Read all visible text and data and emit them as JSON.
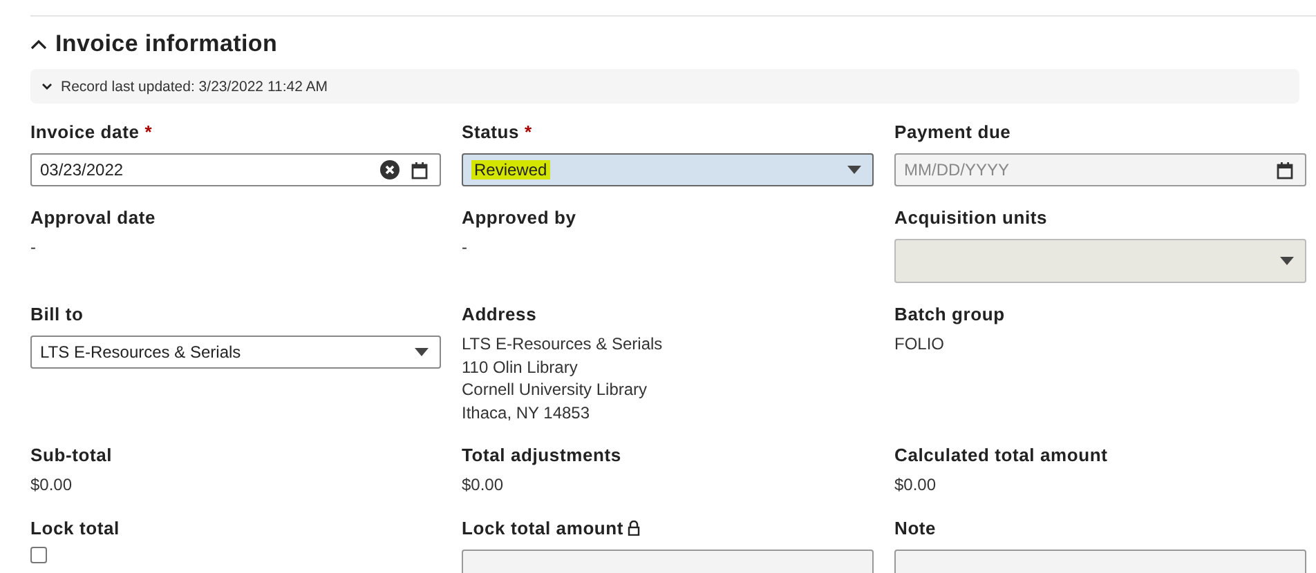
{
  "section": {
    "title": "Invoice information",
    "expanded": true
  },
  "record_bar": {
    "text": "Record last updated: 3/23/2022 11:42 AM",
    "expanded": false
  },
  "fields": [
    {
      "kind": "date",
      "label": "Invoice date",
      "required_mark": "*",
      "value": "03/23/2022",
      "clearable": true
    },
    {
      "kind": "select",
      "label": "Status",
      "required_mark": "*",
      "value": "Reviewed",
      "focused": true,
      "highlighted": true
    },
    {
      "kind": "date",
      "label": "Payment due",
      "placeholder": "MM/DD/YYYY",
      "clearable": false
    },
    {
      "kind": "text",
      "label": "Approval date",
      "value": "-"
    },
    {
      "kind": "text",
      "label": "Approved by",
      "value": "-"
    },
    {
      "kind": "select",
      "label": "Acquisition units",
      "disabled": true
    },
    {
      "kind": "select",
      "label": "Bill to",
      "value": "LTS E-Resources & Serials"
    },
    {
      "kind": "lines",
      "label": "Address",
      "lines": [
        "LTS E-Resources & Serials",
        "110 Olin Library",
        "Cornell University Library",
        "Ithaca, NY 14853"
      ]
    },
    {
      "kind": "text",
      "label": "Batch group",
      "value": "FOLIO"
    },
    {
      "kind": "text",
      "label": "Sub-total",
      "value": "$0.00"
    },
    {
      "kind": "text",
      "label": "Total adjustments",
      "value": "$0.00"
    },
    {
      "kind": "text",
      "label": "Calculated total amount",
      "value": "$0.00"
    },
    {
      "kind": "checkbox",
      "label": "Lock total",
      "checked": false
    },
    {
      "kind": "input",
      "label": "Lock total amount",
      "locked": true
    },
    {
      "kind": "input",
      "label": "Note"
    }
  ]
}
